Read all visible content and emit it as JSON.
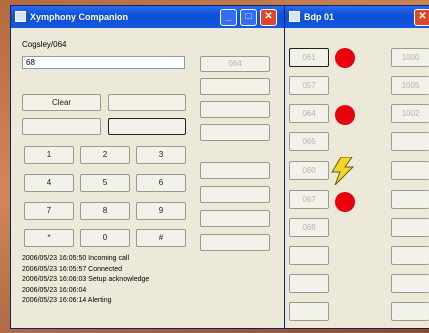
{
  "phone_window": {
    "title": "Xymphony Companion",
    "label": "Cogsley/064",
    "number_value": "68",
    "side_button_label": "064",
    "clear_label": "Clear",
    "keys": [
      "1",
      "2",
      "3",
      "4",
      "5",
      "6",
      "7",
      "8",
      "9",
      "*",
      "0",
      "#"
    ],
    "log": [
      "2006/05/23 16:05:50 Incoming call",
      "2006/05/23 16:05:57 Connected",
      "2006/05/23 16:06:03 Setup acknowledge",
      "2006/05/23 16:06:04",
      "2006/05/23 16:06:14 Alerting"
    ]
  },
  "bdp_window": {
    "title": "Bdp 01",
    "line_labels": [
      "061",
      "057",
      "064",
      "065",
      "060",
      "067",
      "068"
    ],
    "right_labels": [
      "1000",
      "1005",
      "1002"
    ],
    "status_indicators": [
      "red",
      "red",
      "lightning",
      "red"
    ]
  }
}
